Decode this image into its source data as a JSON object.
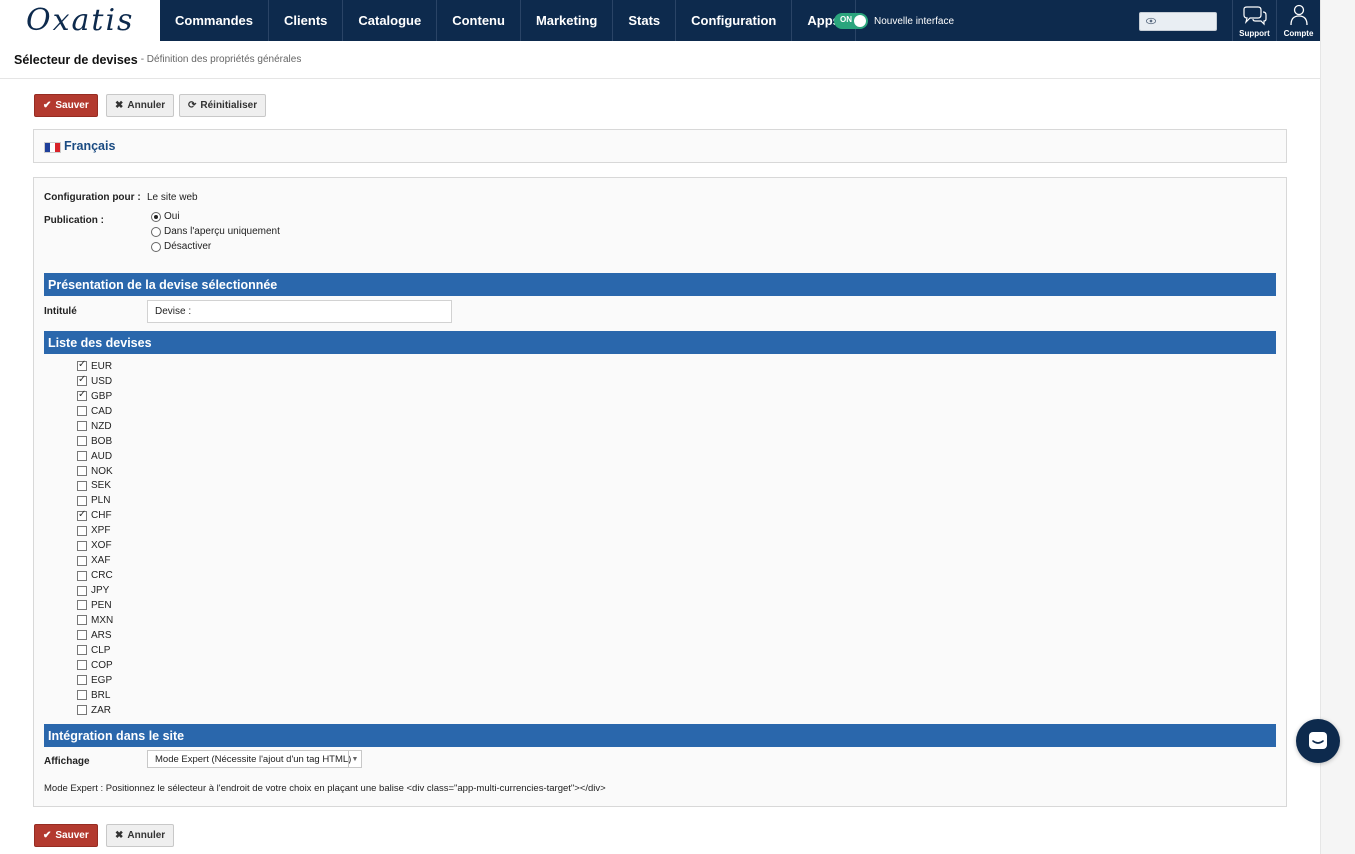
{
  "logo": "Oxatis",
  "nav": [
    "Commandes",
    "Clients",
    "Catalogue",
    "Contenu",
    "Marketing",
    "Stats",
    "Configuration",
    "Apps"
  ],
  "toggle": {
    "state": "ON",
    "label": "Nouvelle interface"
  },
  "top_icons": {
    "support": "Support",
    "account": "Compte"
  },
  "header": {
    "title": "Sélecteur de devises",
    "subtitle": "- Définition des propriétés générales"
  },
  "buttons": {
    "save": "Sauver",
    "cancel": "Annuler",
    "reset": "Réinitialiser"
  },
  "language": "Français",
  "config": {
    "label": "Configuration pour :",
    "value": "Le site web",
    "publication_label": "Publication :",
    "publication_options": [
      {
        "label": "Oui",
        "selected": true
      },
      {
        "label": "Dans l'aperçu uniquement",
        "selected": false
      },
      {
        "label": "Désactiver",
        "selected": false
      }
    ]
  },
  "presentation": {
    "title": "Présentation de la devise sélectionnée",
    "field_label": "Intitulé",
    "field_value": "Devise :"
  },
  "currencies": {
    "title": "Liste des devises",
    "items": [
      {
        "code": "EUR",
        "checked": true
      },
      {
        "code": "USD",
        "checked": true
      },
      {
        "code": "GBP",
        "checked": true
      },
      {
        "code": "CAD",
        "checked": false
      },
      {
        "code": "NZD",
        "checked": false
      },
      {
        "code": "BOB",
        "checked": false
      },
      {
        "code": "AUD",
        "checked": false
      },
      {
        "code": "NOK",
        "checked": false
      },
      {
        "code": "SEK",
        "checked": false
      },
      {
        "code": "PLN",
        "checked": false
      },
      {
        "code": "CHF",
        "checked": true
      },
      {
        "code": "XPF",
        "checked": false
      },
      {
        "code": "XOF",
        "checked": false
      },
      {
        "code": "XAF",
        "checked": false
      },
      {
        "code": "CRC",
        "checked": false
      },
      {
        "code": "JPY",
        "checked": false
      },
      {
        "code": "PEN",
        "checked": false
      },
      {
        "code": "MXN",
        "checked": false
      },
      {
        "code": "ARS",
        "checked": false
      },
      {
        "code": "CLP",
        "checked": false
      },
      {
        "code": "COP",
        "checked": false
      },
      {
        "code": "EGP",
        "checked": false
      },
      {
        "code": "BRL",
        "checked": false
      },
      {
        "code": "ZAR",
        "checked": false
      }
    ]
  },
  "integration": {
    "title": "Intégration dans le site",
    "display_label": "Affichage",
    "display_value": "Mode Expert (Nécessite l'ajout d'un tag HTML)",
    "note": "Mode Expert : Positionnez le sélecteur à l'endroit de votre choix en plaçant une balise <div class=\"app-multi-currencies-target\"></div>"
  },
  "colors": {
    "nav_bg": "#0d2a4d",
    "section_bg": "#2a67ac",
    "save_btn": "#b33a2f",
    "toggle_on": "#2ba57d"
  }
}
